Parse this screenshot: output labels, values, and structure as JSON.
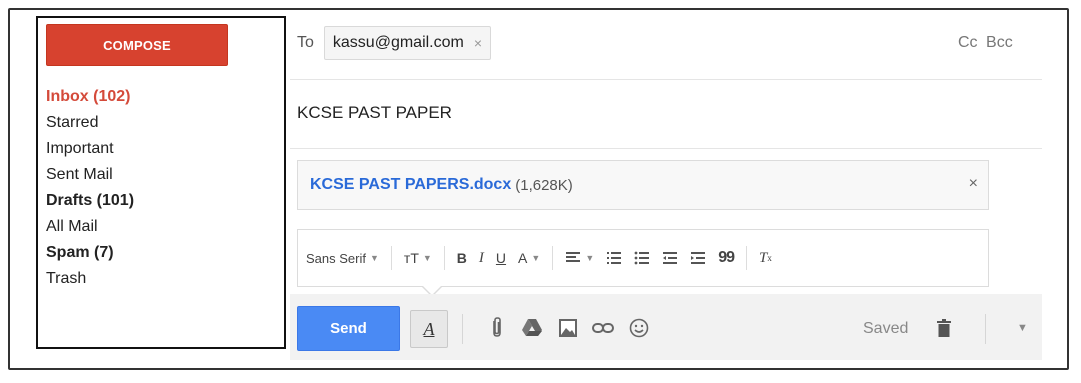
{
  "sidebar": {
    "compose_label": "COMPOSE",
    "items": [
      {
        "label": "Inbox (102)"
      },
      {
        "label": "Starred"
      },
      {
        "label": "Important"
      },
      {
        "label": "Sent Mail"
      },
      {
        "label": "Drafts (101)"
      },
      {
        "label": "All Mail"
      },
      {
        "label": "Spam (7)"
      },
      {
        "label": "Trash"
      }
    ]
  },
  "compose": {
    "to_label": "To",
    "recipient": "kassu@gmail.com",
    "remove_symbol": "×",
    "cc_label": "Cc",
    "bcc_label": "Bcc",
    "subject": "KCSE PAST PAPER",
    "attachment": {
      "name": "KCSE PAST PAPERS.docx",
      "size": "(1,628K)",
      "remove_symbol": "×"
    }
  },
  "toolbar": {
    "font_label": "Sans Serif",
    "size_label": "тT",
    "bold_label": "B",
    "italic_label": "I",
    "underline_label": "U",
    "color_label": "A",
    "quote_label": "99",
    "clear_label": "T",
    "clear_sub": "x"
  },
  "bottom": {
    "send_label": "Send",
    "format_label": "A",
    "saved_label": "Saved"
  },
  "colors": {
    "compose_red": "#d7422f",
    "inbox_red": "#d44a3a",
    "send_blue": "#4a8af4",
    "link_blue": "#2a6ad8"
  }
}
